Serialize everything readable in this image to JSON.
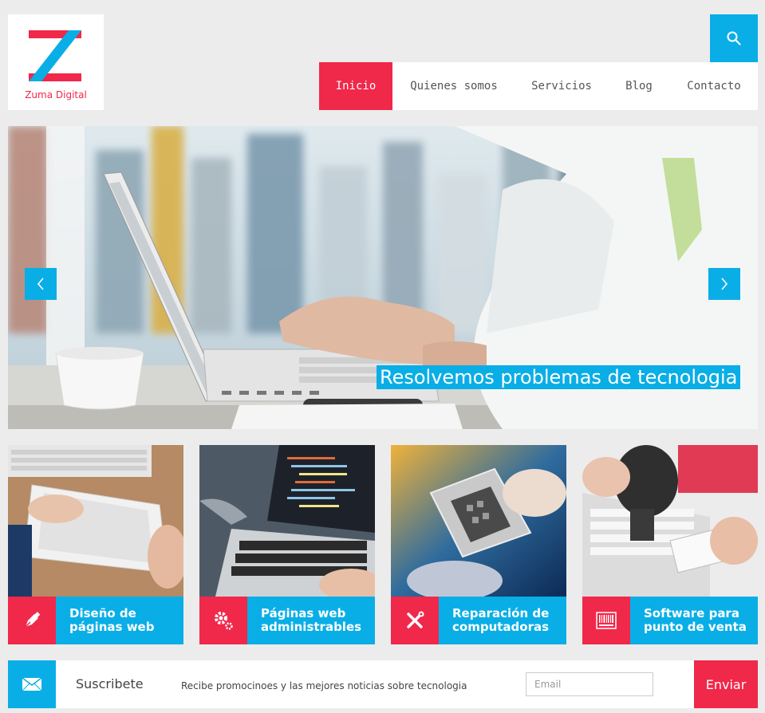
{
  "brand": {
    "name": "Zuma Digital",
    "colors": {
      "red": "#f0284a",
      "blue": "#0aaee6"
    }
  },
  "header": {
    "search_icon": "search-icon"
  },
  "nav": {
    "items": [
      {
        "label": "Inicio",
        "active": true
      },
      {
        "label": "Quienes somos",
        "active": false
      },
      {
        "label": "Servicios",
        "active": false
      },
      {
        "label": "Blog",
        "active": false
      },
      {
        "label": "Contacto",
        "active": false
      }
    ]
  },
  "hero": {
    "caption": "Resolvemos problemas de tecnologia",
    "prev_icon": "chevron-left-icon",
    "next_icon": "chevron-right-icon"
  },
  "services": [
    {
      "title": "Diseño de páginas web",
      "icon": "pen-nib-icon"
    },
    {
      "title": "Páginas web administrables",
      "icon": "gears-icon"
    },
    {
      "title": "Reparación de computadoras",
      "icon": "tools-icon"
    },
    {
      "title": "Software para punto de venta",
      "icon": "barcode-icon"
    }
  ],
  "subscribe": {
    "title": "Suscribete",
    "text": "Recibe promocinoes y las mejores noticias sobre tecnologia",
    "email_placeholder": "Email",
    "email_value": "",
    "button_label": "Enviar",
    "icon": "envelope-icon"
  }
}
